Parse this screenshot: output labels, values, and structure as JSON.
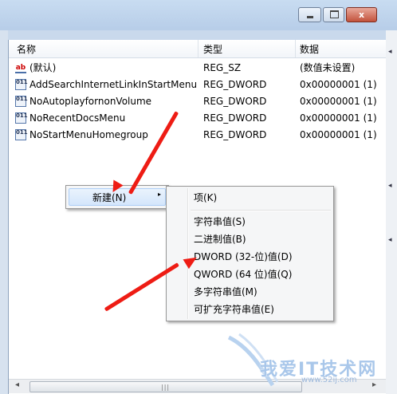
{
  "window": {
    "controls": {
      "minimize_icon": "minimize-icon",
      "maximize_icon": "maximize-icon",
      "close_glyph": "x"
    }
  },
  "columns": {
    "name": "名称",
    "type": "类型",
    "data": "数据"
  },
  "rows": [
    {
      "icon": "string-value-icon",
      "icon_text": "ab",
      "name": "(默认)",
      "type": "REG_SZ",
      "data": "(数值未设置)"
    },
    {
      "icon": "binary-value-icon",
      "icon_text": "011",
      "name": "AddSearchInternetLinkInStartMenu",
      "type": "REG_DWORD",
      "data": "0x00000001 (1)"
    },
    {
      "icon": "binary-value-icon",
      "icon_text": "011",
      "name": "NoAutoplayfornonVolume",
      "type": "REG_DWORD",
      "data": "0x00000001 (1)"
    },
    {
      "icon": "binary-value-icon",
      "icon_text": "011",
      "name": "NoRecentDocsMenu",
      "type": "REG_DWORD",
      "data": "0x00000001 (1)"
    },
    {
      "icon": "binary-value-icon",
      "icon_text": "011",
      "name": "NoStartMenuHomegroup",
      "type": "REG_DWORD",
      "data": "0x00000001 (1)"
    }
  ],
  "context_menu": {
    "new_label": "新建(N)",
    "submenu_arrow": "▸"
  },
  "submenu": {
    "items": [
      "项(K)",
      "字符串值(S)",
      "二进制值(B)",
      "DWORD (32-位)值(D)",
      "QWORD (64 位)值(Q)",
      "多字符串值(M)",
      "可扩充字符串值(E)"
    ]
  },
  "scrollbar": {
    "left_arrow": "◂",
    "right_arrow": "▸",
    "grip": "|||"
  },
  "watermark": {
    "text": "我爱IT技术网",
    "url": "www.52ij.com"
  },
  "colors": {
    "arrow": "#ee1c14",
    "menu_highlight": "#d4e6fb",
    "title_bg": "#c8dcf1"
  }
}
